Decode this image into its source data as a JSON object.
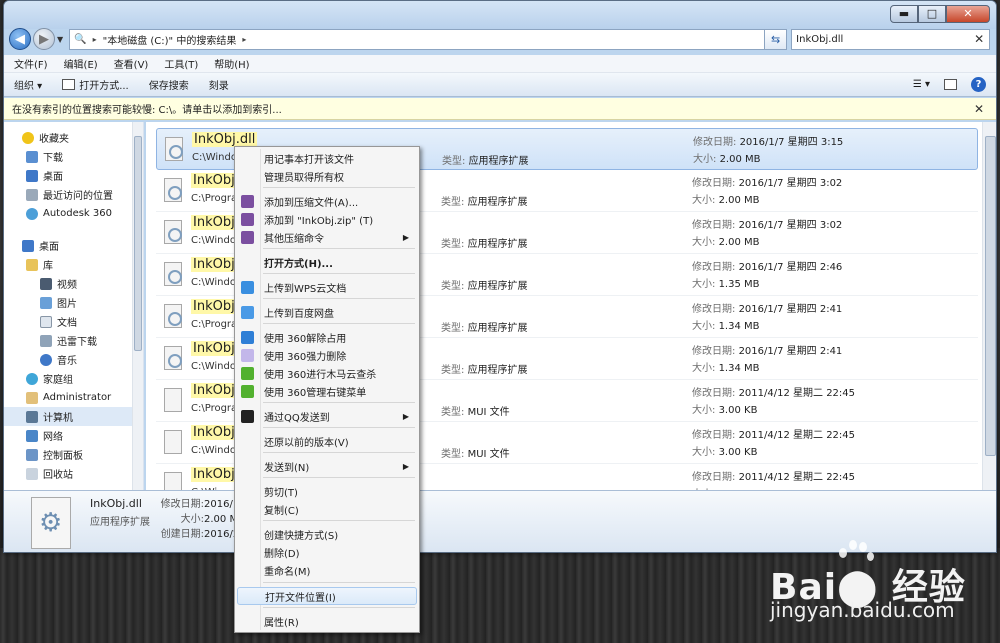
{
  "window": {
    "controls": {
      "minimize": "▬",
      "maximize": "□",
      "close": "✕"
    },
    "address": {
      "path_root": "▸",
      "path_text": "\"本地磁盘 (C:)\" 中的搜索结果",
      "path_arrow": "▸",
      "refresh": "⇆"
    },
    "search": {
      "value": "InkObj.dll",
      "clear": "✕"
    }
  },
  "menubar": {
    "items": [
      "文件(F)",
      "编辑(E)",
      "查看(V)",
      "工具(T)",
      "帮助(H)"
    ]
  },
  "toolbar": {
    "organize": "组织 ▾",
    "open_with": "打开方式...",
    "save_search": "保存搜索",
    "burn": "刻录",
    "help": "?"
  },
  "infobar": {
    "text": "在没有索引的位置搜索可能较慢: C:\\。请单击以添加到索引...",
    "close": "✕"
  },
  "navpane": {
    "favorites": [
      "收藏夹",
      "下载",
      "桌面",
      "最近访问的位置",
      "Autodesk 360"
    ],
    "desktop": [
      "桌面",
      "库",
      "视频",
      "图片",
      "文档",
      "迅雷下载",
      "音乐",
      "家庭组",
      "Administrator",
      "计算机",
      "网络",
      "控制面板",
      "回收站"
    ]
  },
  "results": [
    {
      "name": "InkObj.dll",
      "path": "C:\\Windo",
      "type_label": "类型:",
      "type": "应用程序扩展",
      "date_label": "修改日期:",
      "date": "2016/1/7 星期四 3:15",
      "size_label": "大小:",
      "size": "2.00 MB"
    },
    {
      "name": "InkObj.dll",
      "path": "C:\\Progra",
      "type_label": "类型:",
      "type": "应用程序扩展",
      "date_label": "修改日期:",
      "date": "2016/1/7 星期四 3:02",
      "size_label": "大小:",
      "size": "2.00 MB"
    },
    {
      "name": "InkObj.dll",
      "path": "C:\\Windo",
      "type_label": "类型:",
      "type": "应用程序扩展",
      "date_label": "修改日期:",
      "date": "2016/1/7 星期四 3:02",
      "size_label": "大小:",
      "size": "2.00 MB"
    },
    {
      "name": "InkObj.dll",
      "path": "C:\\Windo",
      "type_label": "类型:",
      "type": "应用程序扩展",
      "date_label": "修改日期:",
      "date": "2016/1/7 星期四 2:46",
      "size_label": "大小:",
      "size": "1.35 MB"
    },
    {
      "name": "InkObj.dll",
      "path": "C:\\Progra",
      "type_label": "类型:",
      "type": "应用程序扩展",
      "date_label": "修改日期:",
      "date": "2016/1/7 星期四 2:41",
      "size_label": "大小:",
      "size": "1.34 MB"
    },
    {
      "name": "InkObj.dll",
      "path": "C:\\Windo",
      "type_label": "类型:",
      "type": "应用程序扩展",
      "date_label": "修改日期:",
      "date": "2016/1/7 星期四 2:41",
      "size_label": "大小:",
      "size": "1.34 MB"
    },
    {
      "name": "InkObj.dll",
      "path": "C:\\Progra",
      "type_label": "类型:",
      "type": "MUI 文件",
      "date_label": "修改日期:",
      "date": "2011/4/12 星期二 22:45",
      "size_label": "大小:",
      "size": "3.00 KB"
    },
    {
      "name": "InkObj.dll",
      "path": "C:\\Windo",
      "type_label": "类型:",
      "type": "MUI 文件",
      "date_label": "修改日期:",
      "date": "2011/4/12 星期二 22:45",
      "size_label": "大小:",
      "size": "3.00 KB"
    },
    {
      "name": "InkObj.dll",
      "path": "C:\\Wi",
      "type_label": "类型:",
      "type": "MUI 文件",
      "date_label": "修改日期:",
      "date": "2011/4/12 星期二 22:45",
      "size_label": "大小:",
      "size": "3.00 KB"
    }
  ],
  "details": {
    "name": "InkObj.dll",
    "type": "应用程序扩展",
    "modified_label": "修改日期:",
    "modified": "2016/1",
    "size_label": "大小:",
    "size": "2.00 M",
    "created_label": "创建日期:",
    "created": "2016/2"
  },
  "context_menu": [
    "用记事本打开该文件",
    "管理员取得所有权",
    "添加到压缩文件(A)...",
    "添加到 \"InkObj.zip\" (T)",
    "其他压缩命令",
    "打开方式(H)...",
    "上传到WPS云文档",
    "上传到百度网盘",
    "使用 360解除占用",
    "使用 360强力删除",
    "使用 360进行木马云查杀",
    "使用 360管理右键菜单",
    "通过QQ发送到",
    "还原以前的版本(V)",
    "发送到(N)",
    "剪切(T)",
    "复制(C)",
    "创建快捷方式(S)",
    "删除(D)",
    "重命名(M)",
    "打开文件位置(I)",
    "属性(R)"
  ],
  "watermark": {
    "logo": "Bai⬤ 经验",
    "url": "jingyan.baidu.com"
  },
  "colors": {
    "accent": "#2b6fc3",
    "highlight": "#fff8a8",
    "infobar": "#ffffe1"
  }
}
